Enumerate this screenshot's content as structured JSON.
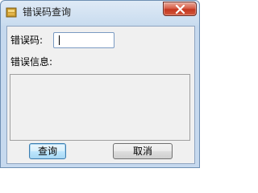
{
  "window": {
    "title": "错误码查询",
    "icon": "app-icon",
    "close_icon": "close-icon"
  },
  "form": {
    "code_label": "错误码:",
    "code_value": "",
    "info_label": "错误信息:",
    "info_value": ""
  },
  "buttons": {
    "query_label": "查询",
    "cancel_label": "取消"
  },
  "colors": {
    "close_button": "#c4371f",
    "default_button_border": "#3c7fb1"
  }
}
